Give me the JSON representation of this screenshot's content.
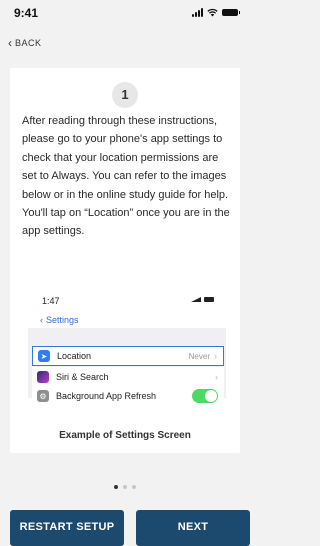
{
  "status_bar": {
    "time": "9:41"
  },
  "nav": {
    "back_label": "BACK",
    "back_icon": "chevron-left"
  },
  "card": {
    "step_number": "1",
    "instructions": "After reading through these instructions, please go to your phone's app settings to check that your location permissions are set to Always. You can refer to the images below or in the online study guide for help. You'll tap on  “Location” once you are in the app settings.",
    "example": {
      "time": "1:47",
      "back_label": "Settings",
      "rows": [
        {
          "label": "Location",
          "value": "Never",
          "icon": "location-arrow-icon",
          "color": "#2f7cf6"
        },
        {
          "label": "Siri & Search",
          "value": "",
          "icon": "siri-icon",
          "color": "#6b4fd8"
        },
        {
          "label": "Background App Refresh",
          "value": "",
          "icon": "gear-icon",
          "color": "#8e8e93",
          "toggle_on": true
        }
      ],
      "caption": "Example of Settings Screen"
    }
  },
  "pagination": {
    "total": 3,
    "current": 1
  },
  "buttons": {
    "restart": "RESTART SETUP",
    "next": "NEXT"
  },
  "colors": {
    "primary": "#1c4a6e",
    "background": "#f2f2f2",
    "toggle_on": "#4cd964",
    "link_blue": "#2b6fd6"
  }
}
